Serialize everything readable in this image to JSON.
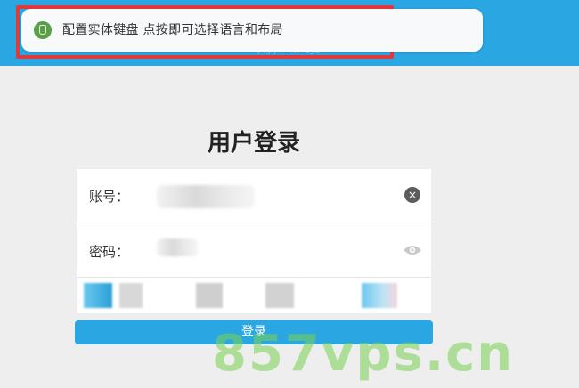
{
  "topbar": {
    "title": "用户登录"
  },
  "notice": {
    "text": "配置实体键盘  点按即可选择语言和布局",
    "icon": "keyboard-settings-icon"
  },
  "login": {
    "title": "用户登录",
    "account_label": "账号：",
    "password_label": "密码：",
    "submit_label": "登录"
  },
  "icons": {
    "clear": "×"
  },
  "watermark": {
    "text": "857vps.cn"
  },
  "colors": {
    "accent": "#2aa6e3",
    "highlight": "#e0393e"
  }
}
